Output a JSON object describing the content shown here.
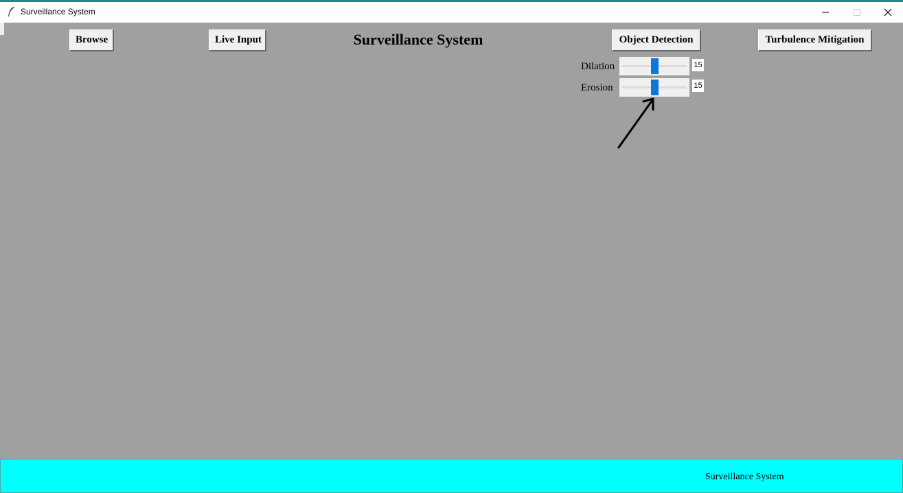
{
  "window": {
    "title": "Surveillance System",
    "controls": {
      "minimize_icon": "minimize-icon",
      "maximize_icon": "maximize-icon",
      "close_icon": "close-icon"
    }
  },
  "toolbar": {
    "browse_label": "Browse",
    "live_input_label": "Live Input",
    "object_detection_label": "Object Detection",
    "turbulence_mitigation_label": "Turbulence Mitigation"
  },
  "app_title": "Surveillance System",
  "sliders": {
    "dilation": {
      "label": "Dilation",
      "value": "15",
      "level": 0.5
    },
    "erosion": {
      "label": "Erosion",
      "value": "15",
      "level": 0.5
    }
  },
  "status_bar": {
    "text": "Surveillance System"
  },
  "colors": {
    "background": "#a0a0a0",
    "status_bar": "#00ffff",
    "slider_thumb": "#0a78d7",
    "window_accent": "#1f8a8a"
  },
  "icons": {
    "app": "feather-icon",
    "annotation": "arrow-icon"
  }
}
